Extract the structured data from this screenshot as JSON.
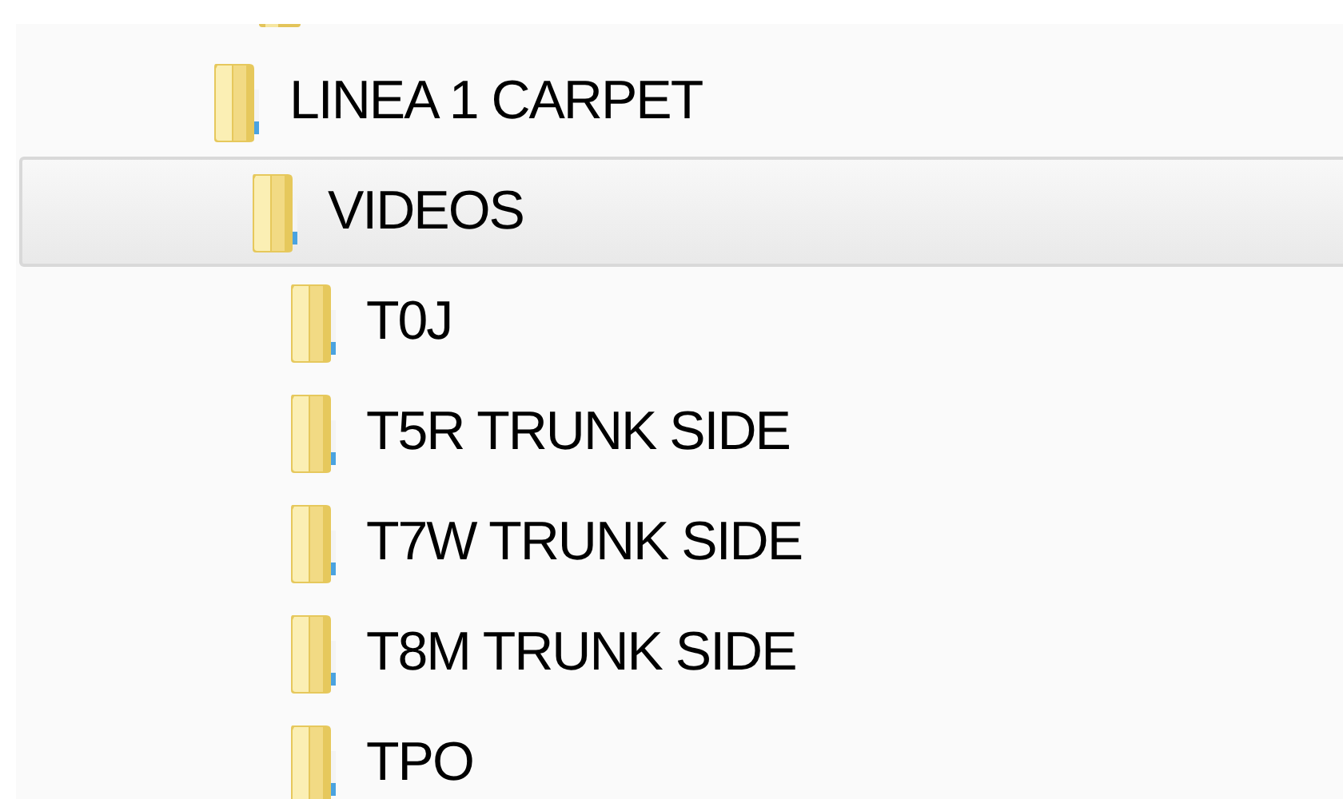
{
  "tree": [
    {
      "label": "LINEA 1 CARPET",
      "selected": false,
      "children": [
        {
          "label": "VIDEOS",
          "selected": true,
          "children": [
            {
              "label": "T0J",
              "selected": false
            },
            {
              "label": "T5R TRUNK SIDE",
              "selected": false
            },
            {
              "label": "T7W TRUNK SIDE",
              "selected": false
            },
            {
              "label": "T8M TRUNK SIDE",
              "selected": false
            },
            {
              "label": "TPO",
              "selected": false
            }
          ]
        }
      ]
    }
  ]
}
